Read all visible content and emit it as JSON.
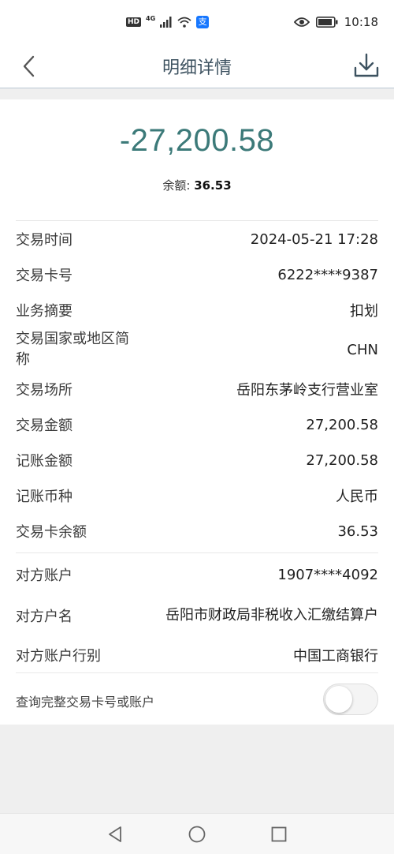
{
  "status_bar": {
    "network_badge": "HD",
    "network_type": "4G",
    "pay_icon_text": "支",
    "time": "10:18",
    "icons": [
      "hd-icon",
      "signal-icon",
      "wifi-icon",
      "alipay-icon",
      "eye-icon",
      "battery-icon"
    ]
  },
  "nav": {
    "title": "明细详情",
    "back_icon": "back-arrow-icon",
    "download_icon": "download-icon"
  },
  "summary": {
    "amount": "-27,200.58",
    "balance_label": "余额: ",
    "balance_value": "36.53"
  },
  "details": [
    {
      "label": "交易时间",
      "value": "2024-05-21 17:28"
    },
    {
      "label": "交易卡号",
      "value": "6222****9387"
    },
    {
      "label": "业务摘要",
      "value": "扣划"
    },
    {
      "label": "交易国家或地区简称",
      "value": "CHN"
    },
    {
      "label": "交易场所",
      "value": "岳阳东茅岭支行营业室"
    },
    {
      "label": "交易金额",
      "value": "27,200.58"
    },
    {
      "label": "记账金额",
      "value": "27,200.58"
    },
    {
      "label": "记账币种",
      "value": "人民币"
    },
    {
      "label": "交易卡余额",
      "value": "36.53"
    }
  ],
  "counterparty": [
    {
      "label": "对方账户",
      "value": "1907****4092"
    },
    {
      "label": "对方户名",
      "value": "岳阳市财政局非税收入汇缴结算户"
    },
    {
      "label": "对方账户行别",
      "value": "中国工商银行"
    }
  ],
  "query_full": {
    "label": "查询完整交易卡号或账户",
    "enabled": false
  },
  "colors": {
    "amount": "#3c7a79",
    "nav_title": "#3d5260",
    "background": "#efefef"
  }
}
